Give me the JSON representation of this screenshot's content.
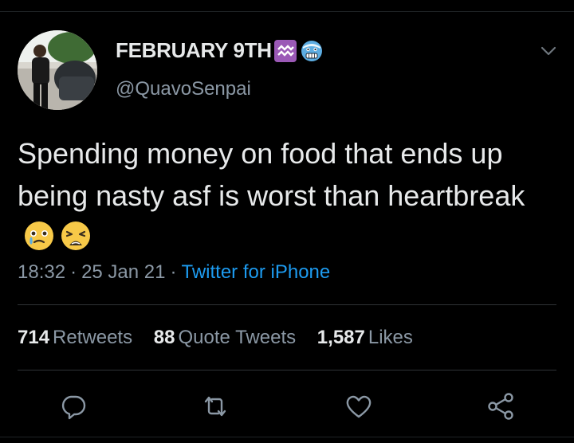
{
  "author": {
    "display_name": "FEBRUARY 9TH",
    "handle": "@QuavoSenpai",
    "name_emojis": [
      "aquarius-icon",
      "cold-face-icon"
    ],
    "avatar": "avatar-photo"
  },
  "tweet": {
    "text": "Spending money on food that ends up being nasty asf is worst than heartbreak",
    "emojis": [
      "face-holding-back-tears-icon",
      "weary-face-icon"
    ],
    "time": "18:32",
    "date": "25 Jan 21",
    "source": "Twitter for iPhone"
  },
  "stats": {
    "retweets_count": "714",
    "retweets_label": "Retweets",
    "quotes_count": "88",
    "quotes_label": "Quote Tweets",
    "likes_count": "1,587",
    "likes_label": "Likes"
  },
  "actions": [
    "reply-icon",
    "retweet-icon",
    "like-icon",
    "share-icon"
  ],
  "colors": {
    "background": "#000000",
    "text": "#e7e9ea",
    "muted": "#8b98a5",
    "link": "#1d9bf0",
    "divider": "#2f3336",
    "aquarius_bg": "#9b59b6"
  }
}
